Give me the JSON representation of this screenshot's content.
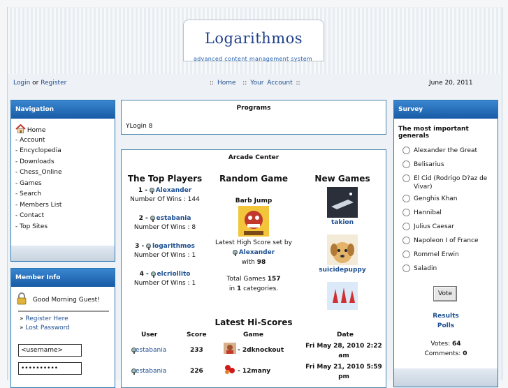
{
  "header": {
    "logo_text": "Logarithmos",
    "tagline": "advanced content management system"
  },
  "topbar": {
    "login": "Login",
    "or": "or",
    "register": "Register",
    "nav_prefix": "::",
    "home": "Home",
    "sep": "::",
    "your_account": "Your Account",
    "nav_suffix": "::",
    "date": "June 20, 2011"
  },
  "navigation": {
    "title": "Navigation",
    "items": [
      "Home",
      "- Account",
      "- Encyclopedia",
      "- Downloads",
      "- Chess_Online",
      "- Games",
      "- Search",
      "- Members List",
      "- Contact",
      "- Top Sites"
    ]
  },
  "member_info": {
    "title": "Member Info",
    "greeting": "Good Morning Guest!",
    "register_here": "Register Here",
    "lost_password": "Lost Password",
    "username_value": "<username>",
    "password_value": "••••••••••"
  },
  "programs": {
    "title": "Programs",
    "item": "YLogin 8"
  },
  "arcade": {
    "title": "Arcade Center",
    "top_players": {
      "heading": "The Top Players",
      "wins_label": "Number Of Wins :",
      "players": [
        {
          "rank": "1 -",
          "name": "Alexander",
          "wins": "144"
        },
        {
          "rank": "2 -",
          "name": "estabania",
          "wins": "8"
        },
        {
          "rank": "3 -",
          "name": "logarithmos",
          "wins": "1"
        },
        {
          "rank": "4 -",
          "name": "elcriollito",
          "wins": "1"
        }
      ]
    },
    "random_game": {
      "heading": "Random Game",
      "game_name": "Barb Jump",
      "score_text": "Latest High Score set by",
      "player": "Alexander",
      "with": "with",
      "score": "98",
      "total_label": "Total Games",
      "total": "157",
      "in_label": "in",
      "categories": "1",
      "categories_label": "categories."
    },
    "new_games": {
      "heading": "New Games",
      "games": [
        "takion",
        "suicidepuppy"
      ]
    },
    "hiscores": {
      "heading": "Latest Hi-Scores",
      "columns": [
        "User",
        "Score",
        "Game",
        "Date"
      ],
      "rows": [
        {
          "user": "estabania",
          "score": "233",
          "game": "- 2dknockout",
          "date_line1": "Fri May 28, 2010 2:22",
          "date_line2": "am"
        },
        {
          "user": "estabania",
          "score": "226",
          "game": "- 12many",
          "date_line1": "Fri May 21, 2010 5:59",
          "date_line2": "pm"
        }
      ]
    }
  },
  "survey": {
    "title": "Survey",
    "question": "The most important generals",
    "options": [
      "Alexander the Great",
      "Belisarius",
      "El Cid (Rodrigo D?az de Vivar)",
      "Genghis Khan",
      "Hannibal",
      "Julius Caesar",
      "Napoleon I of France",
      "Rommel Erwin",
      "Saladin"
    ],
    "vote_button": "Vote",
    "results": "Results",
    "polls": "Polls",
    "votes_label": "Votes:",
    "votes": "64",
    "comments_label": "Comments:",
    "comments": "0"
  },
  "colors": {
    "panel_title_top": "#3a86d0",
    "panel_title_bottom": "#185aa6",
    "link": "#1d4f91",
    "border": "#2b78b0"
  }
}
